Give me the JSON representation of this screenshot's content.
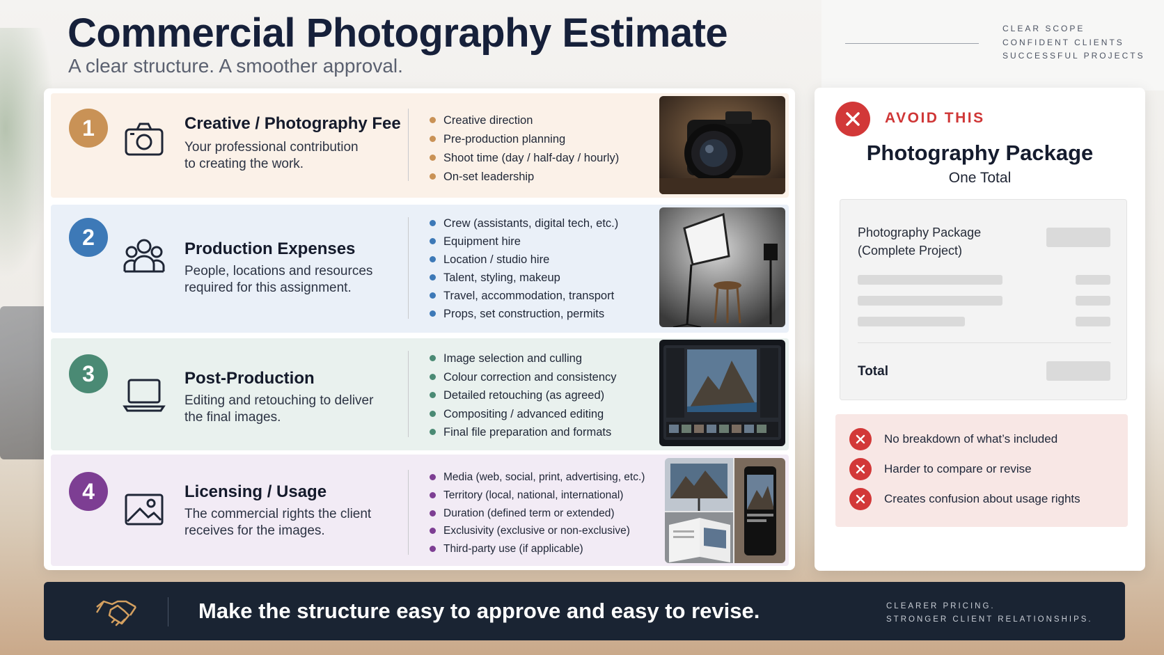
{
  "header": {
    "title": "Commercial Photography Estimate",
    "subtitle": "A clear structure. A smoother approval.",
    "tagline": [
      "CLEAR SCOPE",
      "CONFIDENT CLIENTS",
      "SUCCESSFUL PROJECTS"
    ]
  },
  "sections": [
    {
      "number": "1",
      "color": "#c99256",
      "icon": "camera-icon",
      "title": "Creative / Photography Fee",
      "desc": [
        "Your professional contribution",
        "to creating the work."
      ],
      "bullets": [
        "Creative direction",
        "Pre-production planning",
        "Shoot time (day / half-day / hourly)",
        "On-set leadership"
      ],
      "photo": "camera-photo"
    },
    {
      "number": "2",
      "color": "#3d79b7",
      "icon": "people-icon",
      "title": "Production Expenses",
      "desc": [
        "People, locations and resources",
        "required for this assignment."
      ],
      "bullets": [
        "Crew (assistants, digital tech, etc.)",
        "Equipment hire",
        "Location / studio hire",
        "Talent, styling, makeup",
        "Travel, accommodation, transport",
        "Props, set construction, permits"
      ],
      "photo": "studio-lighting-photo"
    },
    {
      "number": "3",
      "color": "#4a8a74",
      "icon": "laptop-icon",
      "title": "Post-Production",
      "desc": [
        "Editing and retouching to deliver",
        "the final images."
      ],
      "bullets": [
        "Image selection and culling",
        "Colour correction and consistency",
        "Detailed retouching (as agreed)",
        "Compositing / advanced editing",
        "Final file preparation and formats"
      ],
      "photo": "editing-software-photo"
    },
    {
      "number": "4",
      "color": "#7d3e93",
      "icon": "image-icon",
      "title": "Licensing / Usage",
      "desc": [
        "The commercial rights the client",
        "receives for the images."
      ],
      "bullets": [
        "Media (web, social, print, advertising, etc.)",
        "Territory (local, national, international)",
        "Duration (defined term or extended)",
        "Exclusivity (exclusive or non-exclusive)",
        "Third-party use (if applicable)"
      ],
      "photo": "usage-collage-photo"
    }
  ],
  "avoid": {
    "label": "AVOID THIS",
    "title": "Photography Package",
    "subtitle": "One Total",
    "line_item": [
      "Photography Package",
      "(Complete Project)"
    ],
    "total_label": "Total",
    "issues": [
      "No breakdown of what’s included",
      "Harder to compare or revise",
      "Creates confusion about usage rights"
    ],
    "accent": "#d23838"
  },
  "footer": {
    "message": "Make the structure easy to approve and easy to revise.",
    "right": [
      "CLEARER PRICING.",
      "STRONGER CLIENT RELATIONSHIPS."
    ]
  }
}
